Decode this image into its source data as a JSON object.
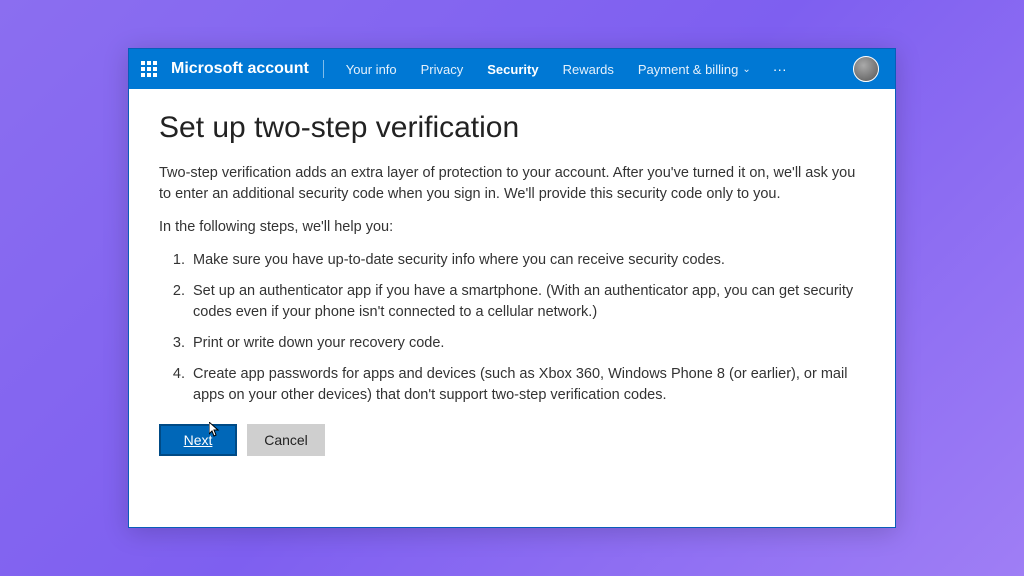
{
  "header": {
    "brand": "Microsoft account",
    "nav": [
      {
        "label": "Your info",
        "active": false
      },
      {
        "label": "Privacy",
        "active": false
      },
      {
        "label": "Security",
        "active": true
      },
      {
        "label": "Rewards",
        "active": false
      }
    ],
    "paymentLabel": "Payment & billing",
    "ellipsis": "···"
  },
  "page": {
    "title": "Set up two-step verification",
    "intro": "Two-step verification adds an extra layer of protection to your account. After you've turned it on, we'll ask you to enter an additional security code when you sign in. We'll provide this security code only to you.",
    "helpLine": "In the following steps, we'll help you:",
    "steps": [
      "Make sure you have up-to-date security info where you can receive security codes.",
      "Set up an authenticator app if you have a smartphone. (With an authenticator app, you can get security codes even if your phone isn't connected to a cellular network.)",
      "Print or write down your recovery code.",
      "Create app passwords for apps and devices (such as Xbox 360, Windows Phone 8 (or earlier), or mail apps on your other devices) that don't support two-step verification codes."
    ],
    "nextLabel": "Next",
    "cancelLabel": "Cancel"
  }
}
